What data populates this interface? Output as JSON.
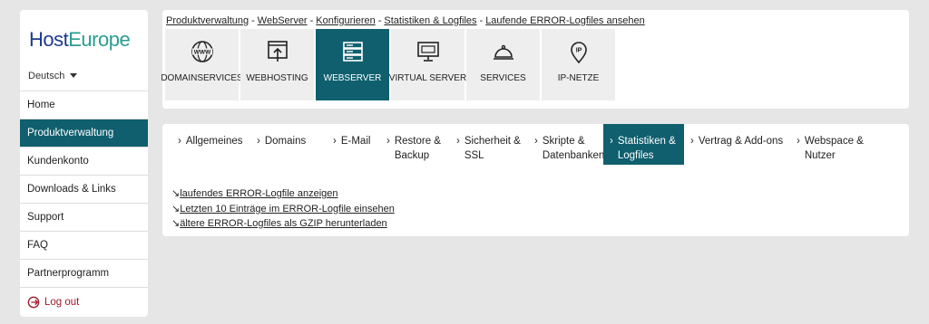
{
  "sidebar": {
    "logo_host": "Host",
    "logo_europe": "Europe",
    "language": "Deutsch",
    "items": [
      {
        "label": "Home"
      },
      {
        "label": "Produktverwaltung"
      },
      {
        "label": "Kundenkonto"
      },
      {
        "label": "Downloads & Links"
      },
      {
        "label": "Support"
      },
      {
        "label": "FAQ"
      },
      {
        "label": "Partnerprogramm"
      }
    ],
    "logout": "Log out"
  },
  "breadcrumb": [
    "Produktverwaltung",
    "WebServer",
    "Konfigurieren",
    "Statistiken & Logfiles",
    "Laufende ERROR-Logfiles ansehen"
  ],
  "breadcrumb_sep": "-",
  "tiles": [
    {
      "label": "DOMAINSERVICES",
      "icon": "www-globe-icon"
    },
    {
      "label": "WEBHOSTING",
      "icon": "browser-upload-icon"
    },
    {
      "label": "WEBSERVER",
      "icon": "server-rack-icon"
    },
    {
      "label": "VIRTUAL SERVER",
      "icon": "monitor-icon"
    },
    {
      "label": "SERVICES",
      "icon": "service-bell-icon"
    },
    {
      "label": "IP-NETZE",
      "icon": "ip-location-icon"
    }
  ],
  "tabs": [
    {
      "label": "Allgemeines"
    },
    {
      "label": "Domains"
    },
    {
      "label": "E-Mail"
    },
    {
      "label": "Restore & Backup"
    },
    {
      "label": "Sicherheit & SSL"
    },
    {
      "label": "Skripte & Datenbanken"
    },
    {
      "label": "Statistiken & Logfiles"
    },
    {
      "label": "Vertrag & Add-ons"
    },
    {
      "label": "Webspace & Nutzer"
    }
  ],
  "links": [
    {
      "arrow": "↘",
      "label": "laufendes ERROR-Logfile anzeigen"
    },
    {
      "arrow": "↘",
      "label": "Letzten 10 Einträge im ERROR-Logfile einsehen"
    },
    {
      "arrow": "↘",
      "label": "ältere ERROR-Logfiles als GZIP herunterladen"
    }
  ],
  "colors": {
    "accent": "#0f5f6e",
    "logo_blue": "#1d3a8f",
    "logo_green": "#2a9d8f",
    "logout": "#a01a2b"
  }
}
